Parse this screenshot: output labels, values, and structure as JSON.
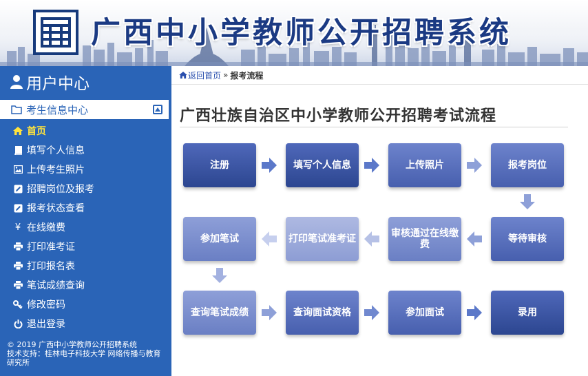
{
  "banner": {
    "title": "广西中小学教师公开招聘系统"
  },
  "sidebar": {
    "header": "用户中心",
    "section": "考生信息中心",
    "items": [
      {
        "label": "首页",
        "icon": "home-icon",
        "active": true
      },
      {
        "label": "填写个人信息",
        "icon": "book-icon"
      },
      {
        "label": "上传考生照片",
        "icon": "image-icon"
      },
      {
        "label": "招聘岗位及报考",
        "icon": "edit-icon"
      },
      {
        "label": "报考状态查看",
        "icon": "edit-icon"
      },
      {
        "label": "在线缴费",
        "icon": "yen-icon"
      },
      {
        "label": "打印准考证",
        "icon": "print-icon"
      },
      {
        "label": "打印报名表",
        "icon": "print-icon"
      },
      {
        "label": "笔试成绩查询",
        "icon": "print-icon"
      },
      {
        "label": "修改密码",
        "icon": "key-icon"
      },
      {
        "label": "退出登录",
        "icon": "power-icon"
      }
    ],
    "footer": {
      "copyright": "© 2019 广西中小学教师公开招聘系统",
      "support": "技术支持：桂林电子科技大学 网络传播与教育研究所"
    }
  },
  "breadcrumb": {
    "home": "返回首页",
    "separator": "»",
    "current": "报考流程"
  },
  "page": {
    "title": "广西壮族自治区中小学教师公开招聘考试流程"
  },
  "flow": {
    "steps": [
      "注册",
      "填写个人信息",
      "上传照片",
      "报考岗位",
      "等待审核",
      "审核通过在线缴费",
      "打印笔试准考证",
      "参加笔试",
      "查询笔试成绩",
      "查询面试资格",
      "参加面试",
      "录用"
    ]
  },
  "colors": {
    "sidebar_bg": "#2a64b7",
    "active_item": "#ffe33d",
    "banner_title": "#1b3a83",
    "step_dark": "#2c4690",
    "arrow": "#5b78c9"
  }
}
